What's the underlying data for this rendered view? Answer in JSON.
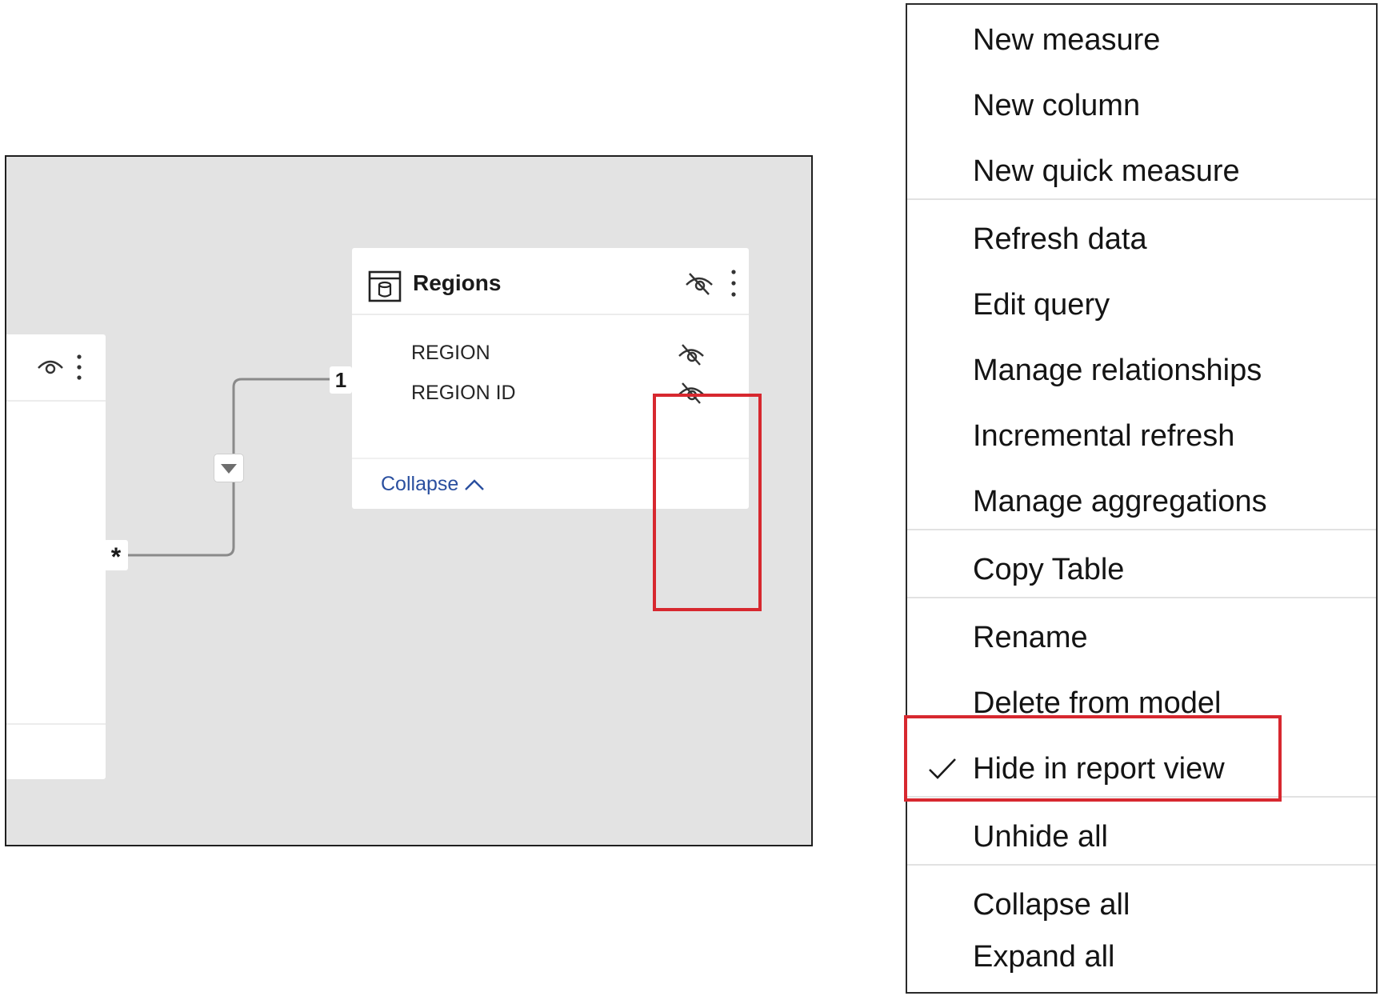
{
  "model_view": {
    "regions_table": {
      "title": "Regions",
      "columns": [
        "REGION",
        "REGION ID"
      ],
      "collapse_label": "Collapse",
      "hidden": true
    },
    "relationship": {
      "one_label": "1",
      "many_label": "*"
    }
  },
  "context_menu": {
    "items": [
      {
        "label": "New measure"
      },
      {
        "label": "New column"
      },
      {
        "label": "New quick measure"
      },
      {
        "label": "Refresh data"
      },
      {
        "label": "Edit query"
      },
      {
        "label": "Manage relationships"
      },
      {
        "label": "Incremental refresh"
      },
      {
        "label": "Manage aggregations"
      },
      {
        "label": "Copy Table"
      },
      {
        "label": "Rename"
      },
      {
        "label": "Delete from model"
      },
      {
        "label": "Hide in report view",
        "checked": true
      },
      {
        "label": "Unhide all"
      },
      {
        "label": "Collapse all"
      },
      {
        "label": "Expand all"
      }
    ]
  },
  "colors": {
    "canvas": "#e3e3e3",
    "highlight": "#d7282f",
    "link": "#2a4f9f"
  },
  "icons": [
    "table-icon",
    "hidden-eye-icon",
    "eye-icon",
    "more-options-icon",
    "check-icon",
    "chevron-up-icon",
    "filter-direction-icon"
  ]
}
